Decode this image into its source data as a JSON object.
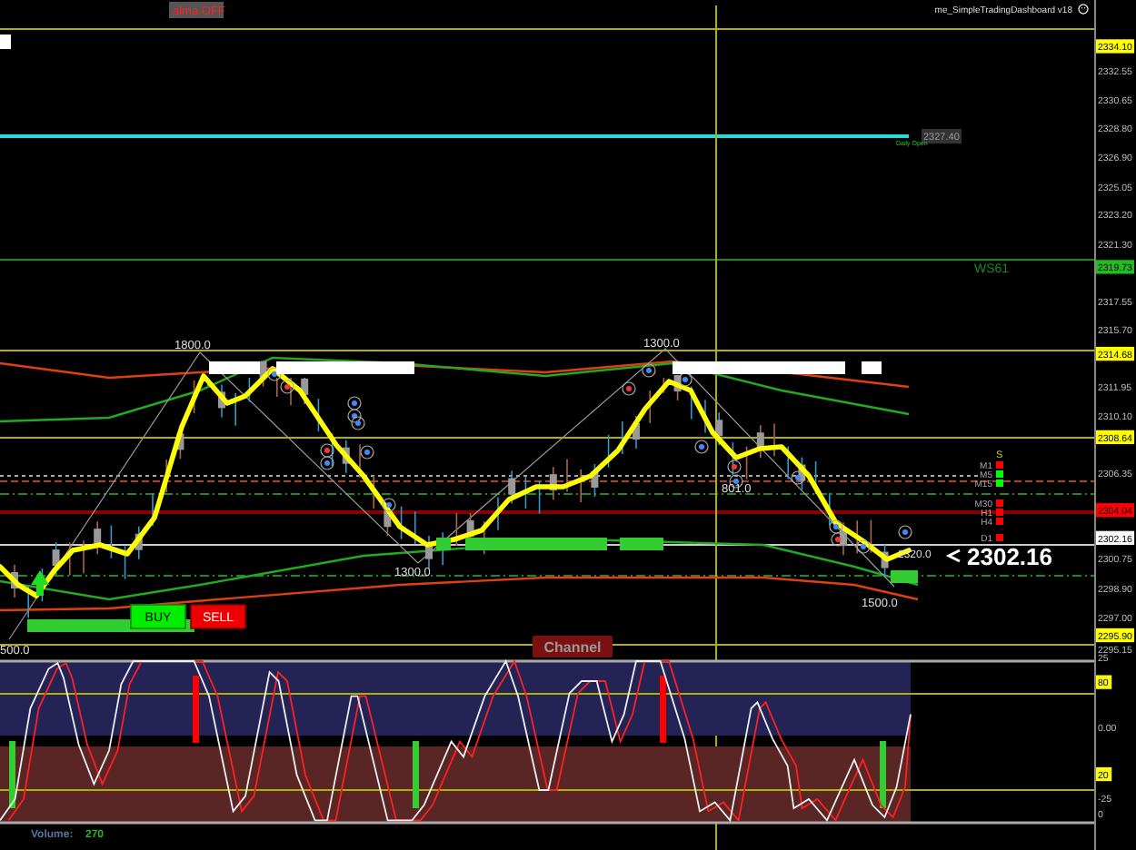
{
  "header": {
    "toggle_label": "alma OFF",
    "indicator_title": "me_SimpleTradingDashboard v18"
  },
  "price_axis": [
    {
      "text": "2334.10",
      "kind": "tag",
      "color": "#ffff00"
    },
    {
      "text": "2332.55",
      "kind": "plain"
    },
    {
      "text": "2330.65",
      "kind": "plain"
    },
    {
      "text": "2328.80",
      "kind": "plain"
    },
    {
      "text": "2326.90",
      "kind": "plain"
    },
    {
      "text": "2325.05",
      "kind": "plain"
    },
    {
      "text": "2323.20",
      "kind": "plain"
    },
    {
      "text": "2321.30",
      "kind": "plain"
    },
    {
      "text": "2319.73",
      "kind": "tag",
      "color": "#22bb22"
    },
    {
      "text": "2317.55",
      "kind": "plain"
    },
    {
      "text": "2315.70",
      "kind": "plain"
    },
    {
      "text": "2314.68",
      "kind": "tag",
      "color": "#ffff00"
    },
    {
      "text": "2311.95",
      "kind": "plain"
    },
    {
      "text": "2310.10",
      "kind": "plain"
    },
    {
      "text": "2308.64",
      "kind": "tag",
      "color": "#ffff00"
    },
    {
      "text": "2306.35",
      "kind": "plain"
    },
    {
      "text": "2304.04",
      "kind": "tag",
      "color": "#ff0000"
    },
    {
      "text": "2302.16",
      "kind": "tag",
      "color": "#ffffff"
    },
    {
      "text": "2300.75",
      "kind": "plain"
    },
    {
      "text": "2298.90",
      "kind": "plain"
    },
    {
      "text": "2297.00",
      "kind": "plain"
    },
    {
      "text": "2295.90",
      "kind": "tag",
      "color": "#ffff00"
    },
    {
      "text": "2295.15",
      "kind": "plain"
    }
  ],
  "chart_labels": {
    "daily_open_price": "2327.40",
    "daily_open": "Daily Open",
    "weekly_level": "WS61",
    "zigzag": [
      "1800.0",
      "1300.0",
      "1300.0",
      "801.0",
      "1500.0",
      "500.0"
    ],
    "level_marker": "2320.0",
    "current_price": "2302.16"
  },
  "trade_buttons": [
    {
      "label": "BUY",
      "kind": "buy"
    },
    {
      "label": "SELL",
      "kind": "sell"
    }
  ],
  "timeframes": {
    "header": "S",
    "items": [
      {
        "label": "M1",
        "color": "#ff0000"
      },
      {
        "label": "M5",
        "color": "#00ff00"
      },
      {
        "label": "M15",
        "color": "#00ff00"
      },
      {
        "label": "M30",
        "color": "#ff0000"
      },
      {
        "label": "H1",
        "color": "#ff0000"
      },
      {
        "label": "H4",
        "color": "#ff0000"
      },
      {
        "label": "D1",
        "color": "#ff0000"
      }
    ]
  },
  "oscillator": {
    "title": "Channel",
    "axis": [
      {
        "text": "25",
        "kind": "plain"
      },
      {
        "text": "80",
        "kind": "tag",
        "color": "#ffff00"
      },
      {
        "text": "0.00",
        "kind": "plain"
      },
      {
        "text": "20",
        "kind": "tag",
        "color": "#ffff00"
      },
      {
        "text": "-25",
        "kind": "plain"
      },
      {
        "text": "0",
        "kind": "plain"
      }
    ]
  },
  "volume": {
    "label": "Volume:",
    "value": "270"
  }
}
